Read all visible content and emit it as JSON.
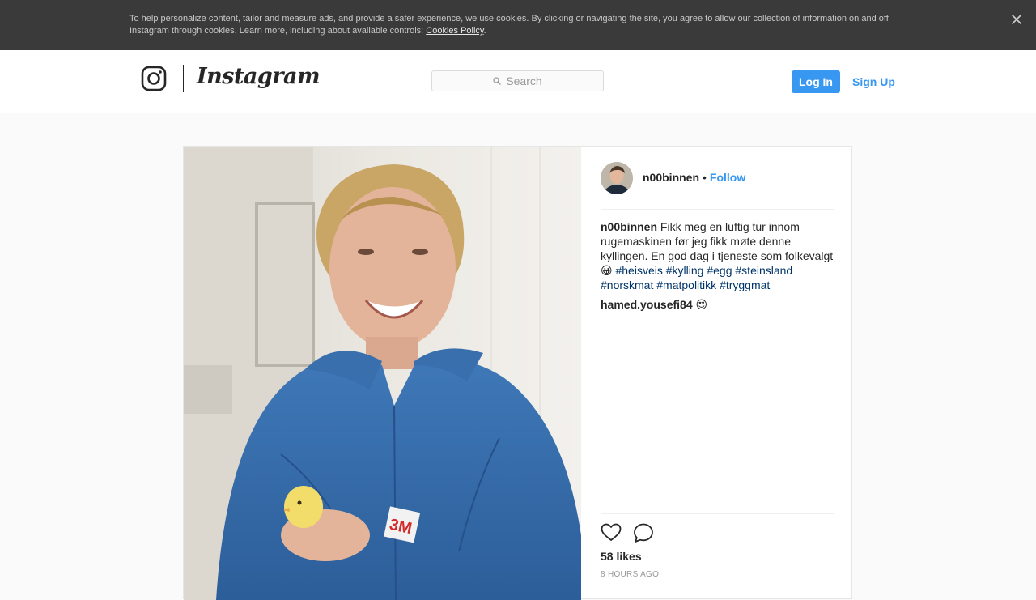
{
  "cookie_banner": {
    "text": "To help personalize content, tailor and measure ads, and provide a safer experience, we use cookies. By clicking or navigating the site, you agree to allow our collection of information on and off Instagram through cookies. Learn more, including about available controls: ",
    "link_label": "Cookies Policy",
    "suffix": ".",
    "close_icon": "close-icon"
  },
  "header": {
    "logo_icon": "instagram-camera-icon",
    "wordmark": "Instagram",
    "search": {
      "placeholder": "Search",
      "icon": "search-icon"
    },
    "login_label": "Log In",
    "signup_label": "Sign Up"
  },
  "post": {
    "username": "n00binnen",
    "separator": "•",
    "follow_label": "Follow",
    "caption": {
      "username": "n00binnen",
      "text": " Fikk meg en luftig tur innom rugemaskinen før jeg fikk møte denne kyllingen. En god dag i tjeneste som folkevalgt 😀 ",
      "hashtags": [
        "#heisveis",
        "#kylling",
        "#egg",
        "#steinsland",
        "#norskmat",
        "#matpolitikk",
        "#tryggmat"
      ]
    },
    "comments": [
      {
        "username": "hamed.yousefi84",
        "text": " 😍"
      }
    ],
    "like_icon": "heart-icon",
    "comment_icon": "speech-bubble-icon",
    "likes": "58 likes",
    "timestamp": "8 HOURS AGO"
  },
  "colors": {
    "accent": "#3897f0",
    "hashtag": "#003569",
    "cookie_bg": "#3a3a3a",
    "page_bg": "#fafafa"
  }
}
